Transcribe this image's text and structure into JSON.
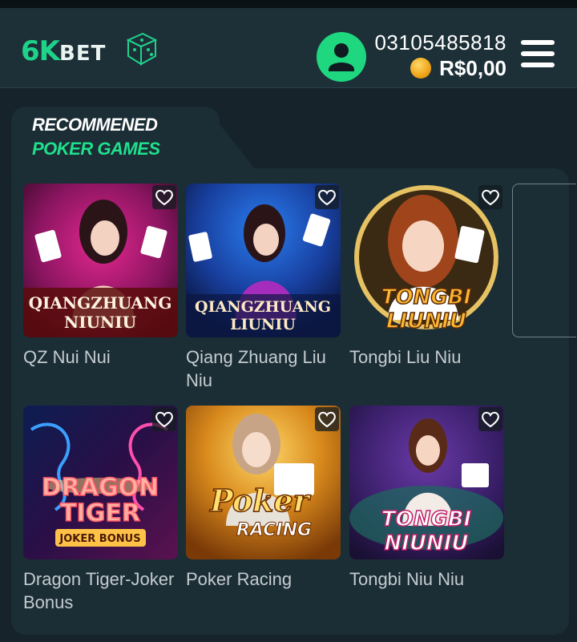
{
  "header": {
    "logo_number": "6",
    "logo_k": "K",
    "logo_bet": "BET",
    "phone": "03105485818",
    "balance": "R$0,00",
    "avatar_icon": "user-icon",
    "menu_icon": "hamburger-menu-icon",
    "coin_icon": "coin-icon"
  },
  "section": {
    "title_line1": "RECOMMENED",
    "title_line2": "POKER GAMES",
    "accent_color": "#1fe08c"
  },
  "games": [
    {
      "name": "QZ Nui Nui",
      "thumb_title_1": "QIANGZHUANG",
      "thumb_title_2": "NIUNIU"
    },
    {
      "name": "Qiang Zhuang Liu Niu",
      "thumb_title_1": "QIANGZHUANG",
      "thumb_title_2": "LIUNIU"
    },
    {
      "name": "Tongbi Liu Niu",
      "thumb_title_1": "TONGBI",
      "thumb_title_2": "LIUNIU"
    },
    {
      "name": "Dragon Tiger-Joker Bonus",
      "thumb_title_1": "DRAGON",
      "thumb_title_2": "TIGER",
      "thumb_title_3": "JOKER BONUS"
    },
    {
      "name": "Poker Racing",
      "thumb_title_1": "Poker",
      "thumb_title_2": "RACING"
    },
    {
      "name": "Tongbi Niu Niu",
      "thumb_title_1": "TONGBI",
      "thumb_title_2": "NIUNIU"
    }
  ]
}
